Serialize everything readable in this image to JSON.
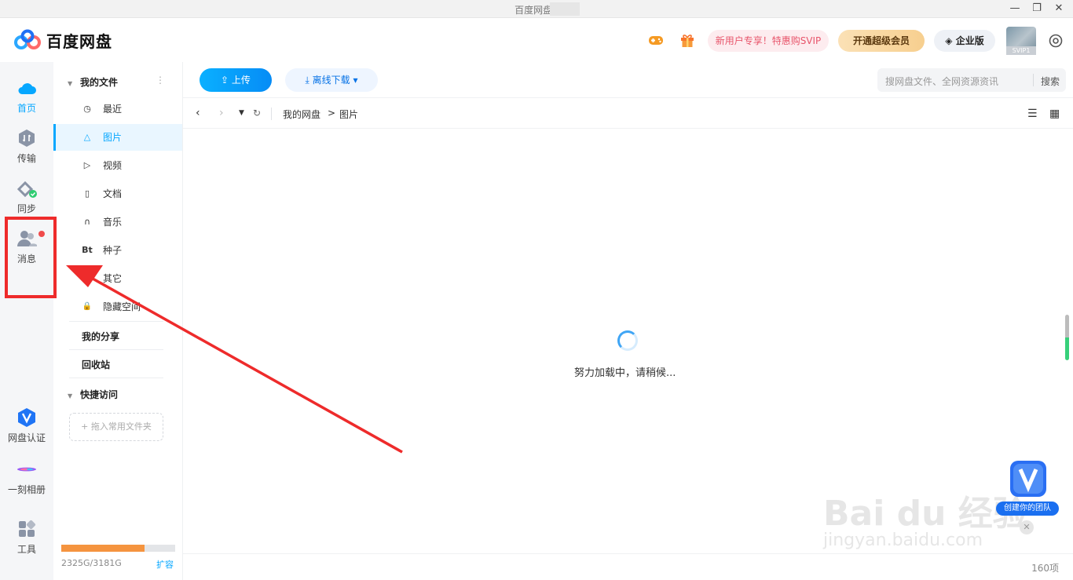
{
  "window": {
    "title": "百度网盘 ·",
    "controls": {
      "minimize": "—",
      "restore": "❐",
      "close": "✕"
    }
  },
  "header": {
    "brand": "百度网盘",
    "promo_new_user": "新用户专享！特惠购SVIP",
    "svip_button": "开通超级会员",
    "enterprise_button": "企业版",
    "avatar_tag": "SVIP1",
    "icons": [
      "game-icon",
      "gift-icon",
      "settings-icon"
    ]
  },
  "leftnav": {
    "items": [
      {
        "label": "首页",
        "icon": "cloud-icon",
        "active": true
      },
      {
        "label": "传输",
        "icon": "transfer-icon"
      },
      {
        "label": "同步",
        "icon": "sync-icon"
      },
      {
        "label": "消息",
        "icon": "message-icon",
        "has_dot": true
      },
      {
        "label": "网盘认证",
        "icon": "verify-icon"
      },
      {
        "label": "一刻相册",
        "icon": "album-icon"
      },
      {
        "label": "工具",
        "icon": "tools-icon"
      }
    ]
  },
  "sidebar": {
    "my_files": "我的文件",
    "more": "⋮",
    "items": [
      {
        "label": "最近",
        "icon": "clock-icon",
        "glyph": "◷"
      },
      {
        "label": "图片",
        "icon": "image-icon",
        "glyph": "△",
        "active": true
      },
      {
        "label": "视频",
        "icon": "video-icon",
        "glyph": "▷"
      },
      {
        "label": "文档",
        "icon": "document-icon",
        "glyph": "▯"
      },
      {
        "label": "音乐",
        "icon": "headphones-icon",
        "glyph": "∩"
      },
      {
        "label": "种子",
        "icon": "bt-icon",
        "glyph": "Bt"
      },
      {
        "label": "其它",
        "icon": "other-icon",
        "glyph": "⋯"
      },
      {
        "label": "隐藏空间",
        "icon": "lock-icon",
        "glyph": "🔒"
      }
    ],
    "my_share": "我的分享",
    "recycle_bin": "回收站",
    "quick_access": "快捷访问",
    "drop_placeholder": "+ 拖入常用文件夹",
    "storage": {
      "used_text": "2325G/3181G",
      "used_fraction": 0.731,
      "expand": "扩容"
    }
  },
  "main": {
    "upload": "上传",
    "offline_download": "离线下载",
    "search_placeholder": "搜网盘文件、全网资源资讯",
    "search_button": "搜索",
    "breadcrumb": [
      "我的网盘",
      ">",
      "图片"
    ],
    "loading": "努力加载中，请稍候...",
    "item_count": "160项"
  },
  "floating": {
    "team_label": "创建你的团队",
    "close": "✕"
  },
  "watermark": {
    "line1": "Bai du 经验",
    "line2": "jingyan.baidu.com"
  },
  "colors": {
    "accent": "#06a7ff",
    "annotation": "#ee2b2b",
    "storage": "#f5943f"
  }
}
